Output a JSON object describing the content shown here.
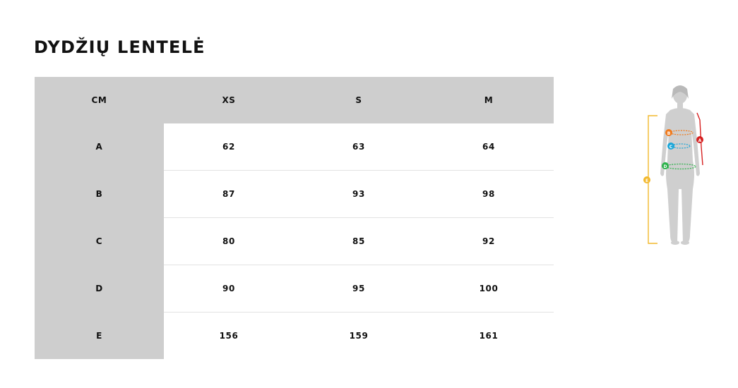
{
  "page": {
    "title": "DYDŽIŲ LENTELĖ"
  },
  "table": {
    "header": [
      "CM",
      "XS",
      "S",
      "M"
    ],
    "rows": [
      {
        "label": "A",
        "values": [
          "62",
          "63",
          "64"
        ]
      },
      {
        "label": "B",
        "values": [
          "87",
          "93",
          "98"
        ]
      },
      {
        "label": "C",
        "values": [
          "80",
          "85",
          "92"
        ]
      },
      {
        "label": "D",
        "values": [
          "90",
          "95",
          "100"
        ]
      },
      {
        "label": "E",
        "values": [
          "156",
          "159",
          "161"
        ]
      }
    ]
  },
  "figure": {
    "markers": [
      "A",
      "B",
      "C",
      "D",
      "E"
    ],
    "colors": {
      "A": "#d62020",
      "B": "#f07a1c",
      "C": "#1aa6d8",
      "D": "#2bb24a",
      "E": "#f2b82c",
      "body": "#cfcfcf"
    }
  }
}
